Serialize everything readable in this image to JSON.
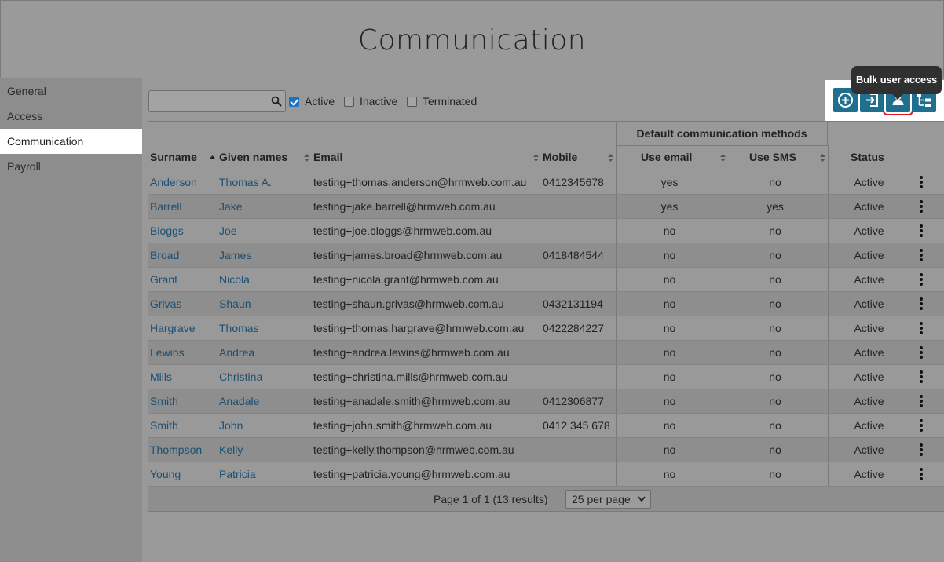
{
  "page": {
    "title": "Communication"
  },
  "sidebar": {
    "items": [
      {
        "label": "General",
        "active": false
      },
      {
        "label": "Access",
        "active": false
      },
      {
        "label": "Communication",
        "active": true
      },
      {
        "label": "Payroll",
        "active": false
      }
    ]
  },
  "search": {
    "value": "",
    "placeholder": ""
  },
  "filters": [
    {
      "label": "Active",
      "checked": true
    },
    {
      "label": "Inactive",
      "checked": false
    },
    {
      "label": "Terminated",
      "checked": false
    }
  ],
  "toolbar": {
    "buttons": [
      {
        "icon": "add-circle-icon"
      },
      {
        "icon": "import-icon"
      },
      {
        "icon": "user-icon"
      },
      {
        "icon": "hierarchy-icon"
      }
    ],
    "tooltip": "Bulk user access"
  },
  "table": {
    "group_header": "Default communication methods",
    "columns": {
      "surname": "Surname",
      "given": "Given names",
      "email": "Email",
      "mobile": "Mobile",
      "use_email": "Use email",
      "use_sms": "Use SMS",
      "status": "Status"
    },
    "rows": [
      {
        "surname": "Anderson",
        "given": "Thomas A.",
        "email": "testing+thomas.anderson@hrmweb.com.au",
        "mobile": "0412345678",
        "use_email": "yes",
        "use_sms": "no",
        "status": "Active"
      },
      {
        "surname": "Barrell",
        "given": "Jake",
        "email": "testing+jake.barrell@hrmweb.com.au",
        "mobile": "",
        "use_email": "yes",
        "use_sms": "yes",
        "status": "Active"
      },
      {
        "surname": "Bloggs",
        "given": "Joe",
        "email": "testing+joe.bloggs@hrmweb.com.au",
        "mobile": "",
        "use_email": "no",
        "use_sms": "no",
        "status": "Active"
      },
      {
        "surname": "Broad",
        "given": "James",
        "email": "testing+james.broad@hrmweb.com.au",
        "mobile": "0418484544",
        "use_email": "no",
        "use_sms": "no",
        "status": "Active"
      },
      {
        "surname": "Grant",
        "given": "Nicola",
        "email": "testing+nicola.grant@hrmweb.com.au",
        "mobile": "",
        "use_email": "no",
        "use_sms": "no",
        "status": "Active"
      },
      {
        "surname": "Grivas",
        "given": "Shaun",
        "email": "testing+shaun.grivas@hrmweb.com.au",
        "mobile": "0432131194",
        "use_email": "no",
        "use_sms": "no",
        "status": "Active"
      },
      {
        "surname": "Hargrave",
        "given": "Thomas",
        "email": "testing+thomas.hargrave@hrmweb.com.au",
        "mobile": "0422284227",
        "use_email": "no",
        "use_sms": "no",
        "status": "Active"
      },
      {
        "surname": "Lewins",
        "given": "Andrea",
        "email": "testing+andrea.lewins@hrmweb.com.au",
        "mobile": "",
        "use_email": "no",
        "use_sms": "no",
        "status": "Active"
      },
      {
        "surname": "Mills",
        "given": "Christina",
        "email": "testing+christina.mills@hrmweb.com.au",
        "mobile": "",
        "use_email": "no",
        "use_sms": "no",
        "status": "Active"
      },
      {
        "surname": "Smith",
        "given": "Anadale",
        "email": "testing+anadale.smith@hrmweb.com.au",
        "mobile": "0412306877",
        "use_email": "no",
        "use_sms": "no",
        "status": "Active"
      },
      {
        "surname": "Smith",
        "given": "John",
        "email": "testing+john.smith@hrmweb.com.au",
        "mobile": "0412 345 678",
        "use_email": "no",
        "use_sms": "no",
        "status": "Active"
      },
      {
        "surname": "Thompson",
        "given": "Kelly",
        "email": "testing+kelly.thompson@hrmweb.com.au",
        "mobile": "",
        "use_email": "no",
        "use_sms": "no",
        "status": "Active"
      },
      {
        "surname": "Young",
        "given": "Patricia",
        "email": "testing+patricia.young@hrmweb.com.au",
        "mobile": "",
        "use_email": "no",
        "use_sms": "no",
        "status": "Active"
      }
    ]
  },
  "pagination": {
    "summary": "Page 1 of 1 (13 results)",
    "per_page": "25 per page"
  },
  "colors": {
    "accent": "#1f6f8f",
    "link": "#1c4f73",
    "highlight": "#e0161f",
    "checkbox": "#1a73c8"
  }
}
